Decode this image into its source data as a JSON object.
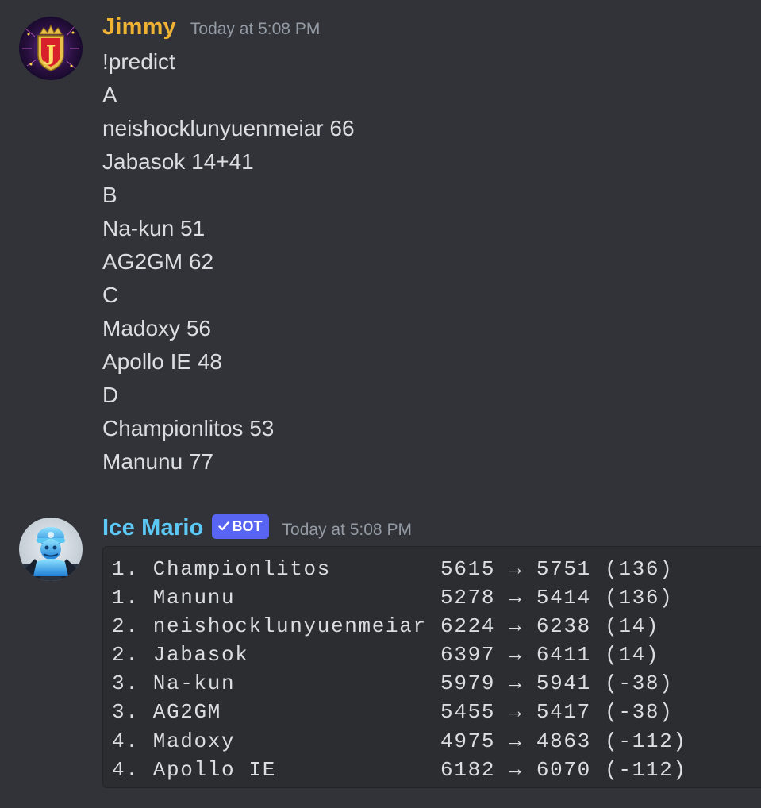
{
  "messages": [
    {
      "author": "Jimmy",
      "author_color": "#f0b232",
      "timestamp": "Today at 5:08 PM",
      "avatar_icon": "crown-j-badge-icon",
      "lines": [
        "!predict",
        "A",
        "neishocklunyuenmeiar 66",
        "Jabasok 14+41",
        "B",
        "Na-kun 51",
        "AG2GM 62",
        "C",
        "Madoxy 56",
        "Apollo IE 48",
        "D",
        "Championlitos 53",
        "Manunu 77"
      ]
    },
    {
      "author": "Ice Mario",
      "author_color": "#5bc8f5",
      "bot_tag": "BOT",
      "bot_tag_color": "#5865f2",
      "timestamp": "Today at 5:08 PM",
      "avatar_icon": "ice-mario-icon",
      "code_lines": [
        "1. Championlitos        5615 → 5751 (136)",
        "1. Manunu               5278 → 5414 (136)",
        "2. neishocklunyuenmeiar 6224 → 6238 (14)",
        "2. Jabasok              6397 → 6411 (14)",
        "3. Na-kun               5979 → 5941 (-38)",
        "3. AG2GM                5455 → 5417 (-38)",
        "4. Madoxy               4975 → 4863 (-112)",
        "4. Apollo IE            6182 → 6070 (-112)"
      ]
    }
  ]
}
